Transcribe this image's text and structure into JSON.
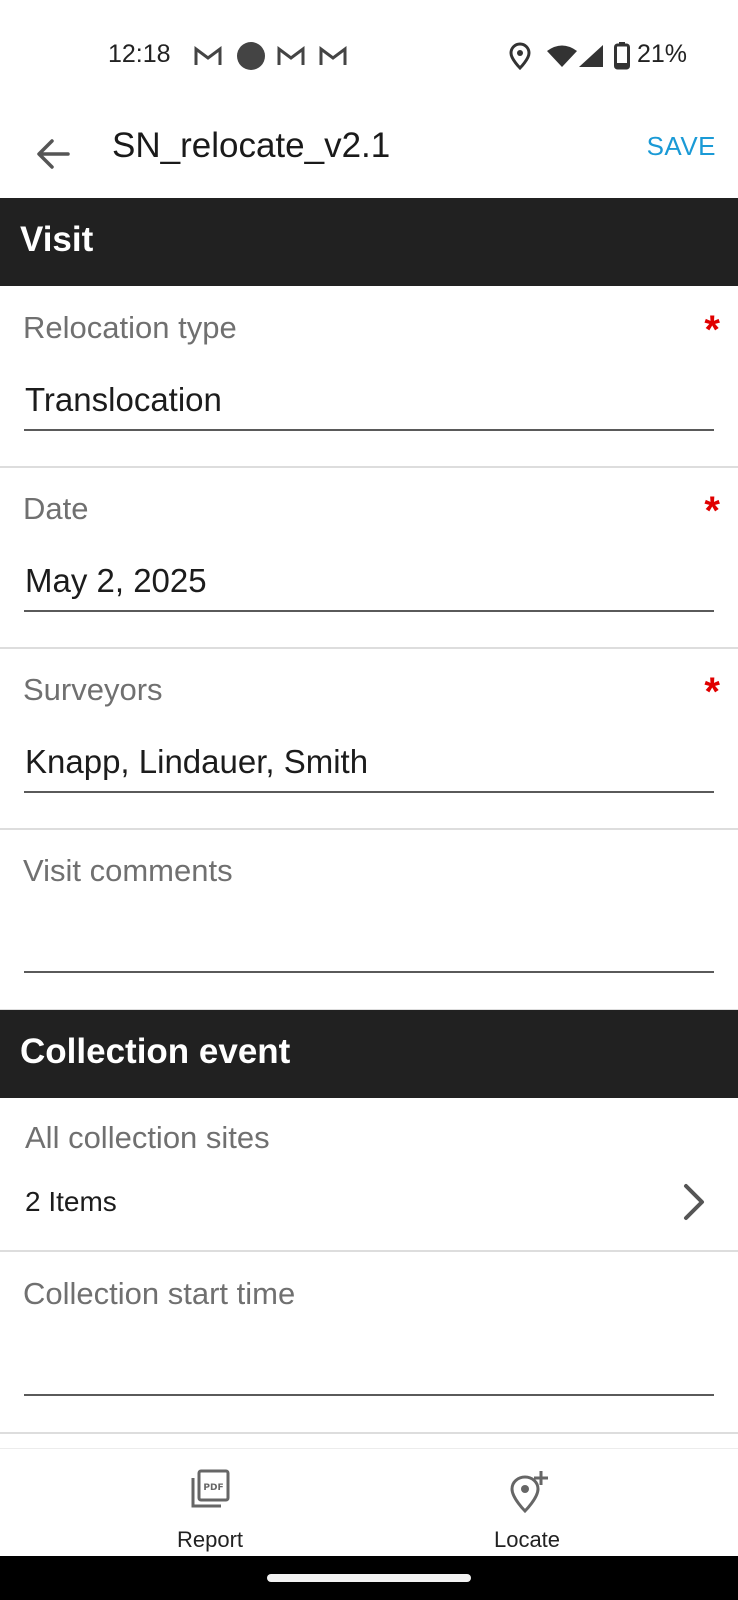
{
  "status_bar": {
    "time": "12:18",
    "battery": "21%",
    "icons": [
      "gmail-icon",
      "dot-icon",
      "gmail-icon",
      "gmail-icon",
      "location-icon",
      "wifi-icon",
      "cell-signal-icon",
      "battery-icon"
    ]
  },
  "app_bar": {
    "title": "SN_relocate_v2.1",
    "save_label": "SAVE",
    "back_icon": "arrow-back-icon"
  },
  "sections": {
    "visit_title": "Visit",
    "collection_title": "Collection event"
  },
  "fields": {
    "relocation_type": {
      "label": "Relocation type",
      "value": "Translocation",
      "required": "*"
    },
    "date": {
      "label": "Date",
      "value": "May 2, 2025",
      "required": "*"
    },
    "surveyors": {
      "label": "Surveyors",
      "value": "Knapp, Lindauer, Smith",
      "required": "*"
    },
    "visit_comments": {
      "label": "Visit comments",
      "value": ""
    },
    "all_collection_sites": {
      "label": "All collection sites",
      "value": "2 Items"
    },
    "collection_start_time": {
      "label": "Collection start time",
      "value": ""
    }
  },
  "bottom_nav": {
    "report_label": "Report",
    "locate_label": "Locate"
  },
  "colors": {
    "accent": "#1a9ad6",
    "required": "#e00000",
    "header_bg": "#212121"
  }
}
